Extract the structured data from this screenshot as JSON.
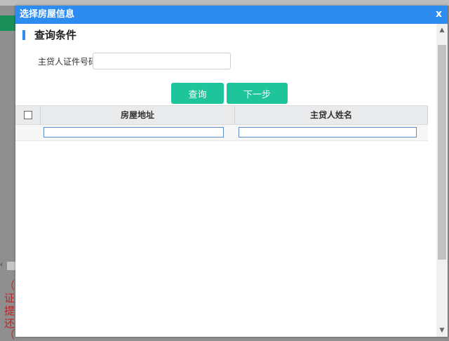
{
  "dialog": {
    "title": "选择房屋信息",
    "close_label": "x"
  },
  "section": {
    "title": "查询条件"
  },
  "form": {
    "id_label": "主贷人证件号码",
    "id_value": ""
  },
  "buttons": {
    "query": "查询",
    "next": "下一步"
  },
  "table": {
    "columns": [
      "房屋地址",
      "主贷人姓名"
    ],
    "rows": [
      {
        "address": "",
        "borrower_name": ""
      }
    ]
  },
  "background": {
    "red_text": [
      "（",
      "证",
      "提",
      "还",
      "（"
    ]
  },
  "colors": {
    "titlebar": "#2d8cf0",
    "button": "#1ec49a",
    "background_text": "#c82020"
  }
}
